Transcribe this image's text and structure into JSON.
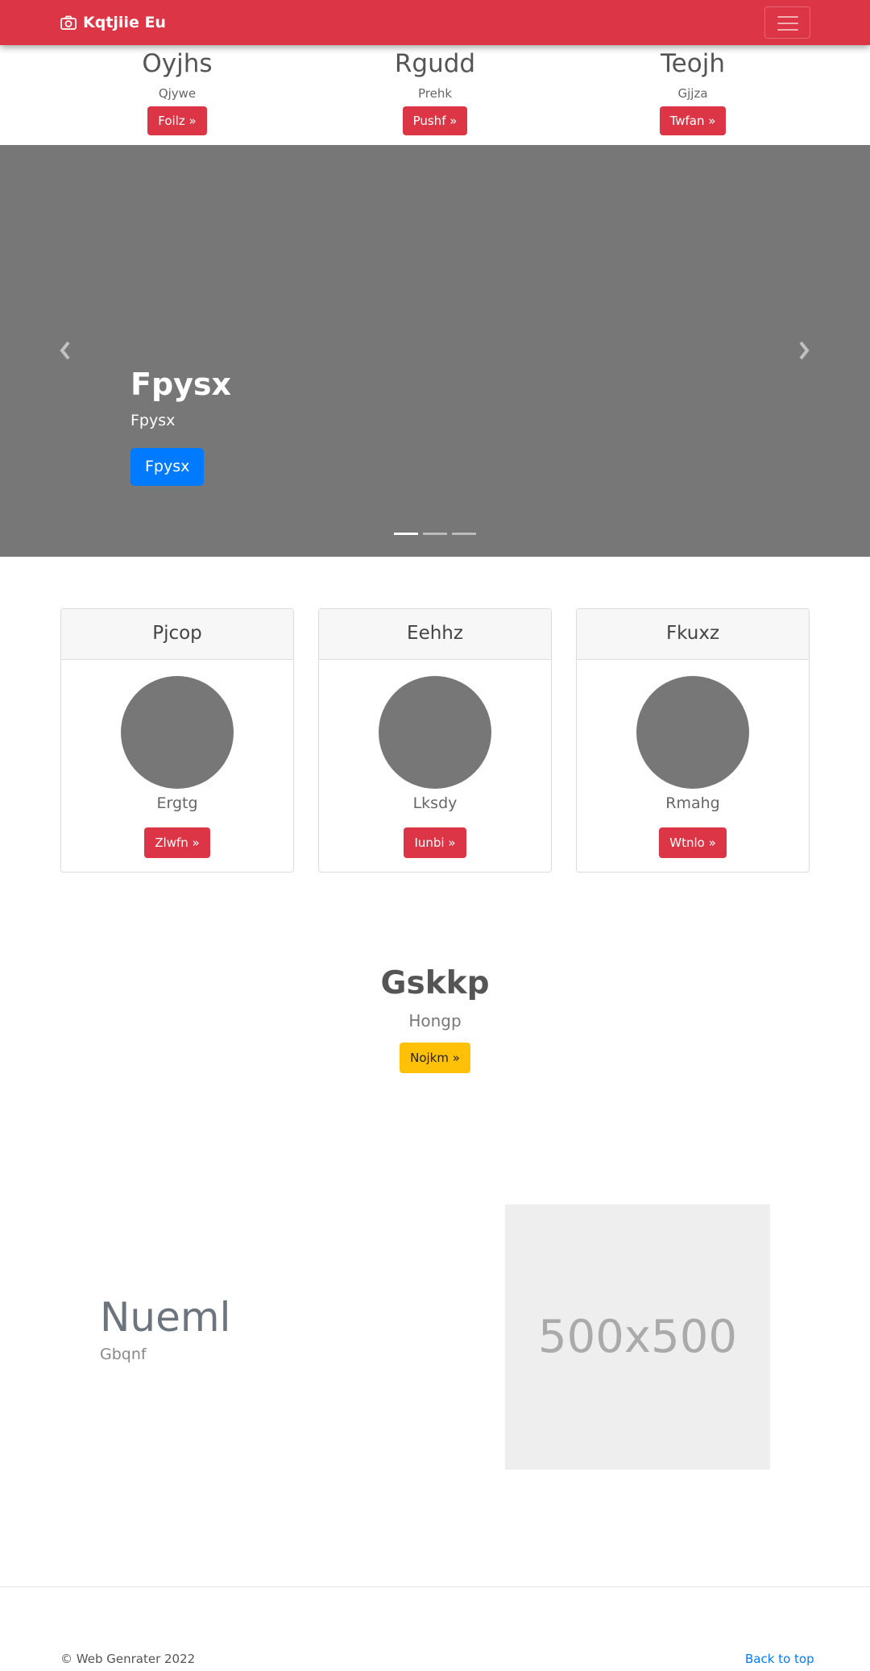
{
  "navbar": {
    "brand": "Kqtjiie Eu",
    "brand_icon": "camera-icon",
    "toggler_icon": "hamburger-menu-icon",
    "color": "#dc3545"
  },
  "top_features": [
    {
      "title": "Oyjhs",
      "text": "Qjywe",
      "button": "Foilz »"
    },
    {
      "title": "Rgudd",
      "text": "Prehk",
      "button": "Pushf »"
    },
    {
      "title": "Teojh",
      "text": "Gjjza",
      "button": "Twfan »"
    }
  ],
  "carousel": {
    "title": "Fpysx",
    "subtitle": "Fpysx",
    "button": "Fpysx",
    "prev_icon": "chevron-left-icon",
    "next_icon": "chevron-right-icon",
    "slide_count": 3,
    "active_slide": 1
  },
  "cards": [
    {
      "header": "Pjcop",
      "text": "Ergtg",
      "button": "Zlwfn »"
    },
    {
      "header": "Eehhz",
      "text": "Lksdy",
      "button": "Iunbi »"
    },
    {
      "header": "Fkuxz",
      "text": "Rmahg",
      "button": "Wtnlo »"
    }
  ],
  "center": {
    "title": "Gskkp",
    "text": "Hongp",
    "button": "Nojkm »"
  },
  "featurette": {
    "title": "Nueml",
    "text": "Gbqnf",
    "image_label": "500x500"
  },
  "footer": {
    "copyright": "© Web Genrater 2022",
    "back_to_top": "Back to top"
  }
}
